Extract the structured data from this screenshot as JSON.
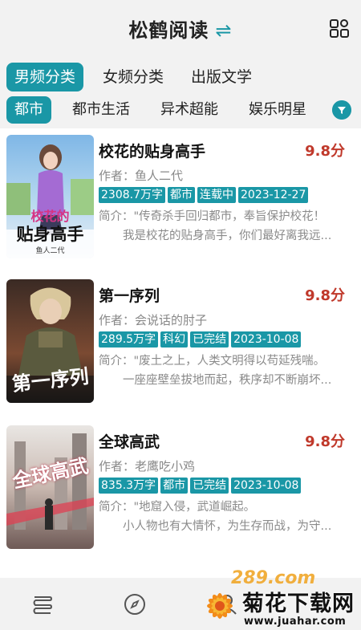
{
  "header": {
    "title": "松鹤阅读",
    "swap_icon": "⇌",
    "menu_icon": "grid-menu-icon"
  },
  "main_tabs": [
    {
      "label": "男频分类",
      "active": true
    },
    {
      "label": "女频分类",
      "active": false
    },
    {
      "label": "出版文学",
      "active": false
    }
  ],
  "sub_tabs": [
    {
      "label": "都市",
      "active": true
    },
    {
      "label": "都市生活",
      "active": false
    },
    {
      "label": "异术超能",
      "active": false
    },
    {
      "label": "娱乐明星",
      "active": false
    }
  ],
  "filter_icon": "filter-icon",
  "books": [
    {
      "title": "校花的贴身高手",
      "score": "9.8分",
      "author": "作者：鱼人二代",
      "tags": [
        "2308.7万字",
        "都市",
        "连载中",
        "2023-12-27"
      ],
      "intro_line1": "简介：\"传奇杀手回归都市，奉旨保护校花！",
      "intro_line2": "我是校花的贴身高手，你们最好离我远...",
      "cover_text_1": "校花的",
      "cover_text_2": "贴身高手",
      "cover_author": "鱼人二代"
    },
    {
      "title": "第一序列",
      "score": "9.8分",
      "author": "作者：会说话的肘子",
      "tags": [
        "289.5万字",
        "科幻",
        "已完结",
        "2023-10-08"
      ],
      "intro_line1": "简介：\"废土之上，人类文明得以苟延残喘。",
      "intro_line2": "一座座壁垒拔地而起，秩序却不断崩坏...",
      "cover_text_1": "第一序列"
    },
    {
      "title": "全球高武",
      "score": "9.8分",
      "author": "作者：老鹰吃小鸡",
      "tags": [
        "835.3万字",
        "都市",
        "已完结",
        "2023-10-08"
      ],
      "intro_line1": "简介：\"地窟入侵，武道崛起。",
      "intro_line2": "小人物也有大情怀，为生存而战，为守...",
      "cover_text_1": "全球高武"
    }
  ],
  "bottom_nav": [
    {
      "icon": "bookshelf-icon"
    },
    {
      "icon": "compass-icon"
    },
    {
      "icon": "profile-icon"
    }
  ],
  "watermark": {
    "title": "菊花下载网",
    "url": "www.juahar.com",
    "overlay": "289.com"
  },
  "colors": {
    "accent": "#1a97a6",
    "score": "#c0392b",
    "bar_bg": "#f2f2f2"
  }
}
